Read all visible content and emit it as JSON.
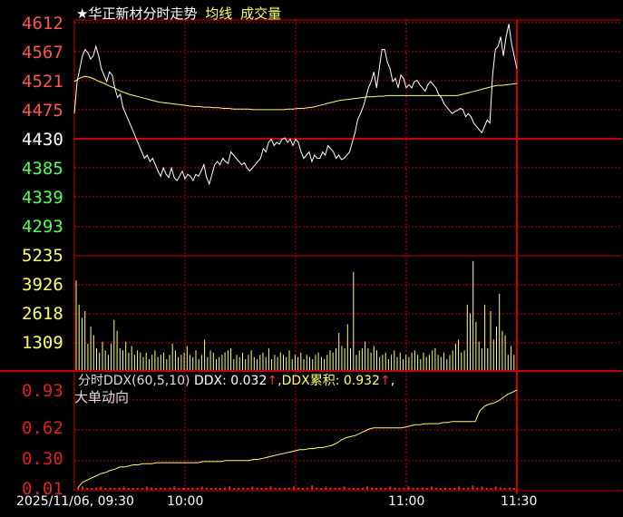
{
  "header": {
    "star": "★",
    "stock": "华正新材",
    "chart_name": "分时走势",
    "avg_label": "均线",
    "vol_label": "成交量"
  },
  "ddx_header": {
    "indicator": "分时DDX(60,5,10)",
    "ddx_label": "DDX: 0.032",
    "ddx_arrow": "↑",
    "ddx_sep": ",",
    "cum_label": "DDX累积: 0.932",
    "cum_arrow": "↑",
    "cum_sep": ",",
    "big_order": "大单动向"
  },
  "colors": {
    "background": "#000000",
    "grid": "#c80000",
    "price_line": "#ffffff",
    "avg_line": "#ffff66",
    "up_label": "#ff5555",
    "down_label": "#55ff55",
    "vol_label": "#ffff66",
    "ddx_label": "#dd2222",
    "vol_bar": "#ffff80"
  },
  "chart_data": [
    {
      "type": "line",
      "name": "price",
      "y_ticks": [
        "4612",
        "4567",
        "4521",
        "4475",
        "4430",
        "4385",
        "4339",
        "4293"
      ],
      "ylim": [
        4293,
        4612
      ],
      "prev_close": 4430,
      "series": [
        {
          "name": "price",
          "values": [
            4470,
            4520,
            4540,
            4560,
            4570,
            4565,
            4555,
            4560,
            4575,
            4560,
            4540,
            4530,
            4520,
            4535,
            4530,
            4510,
            4495,
            4500,
            4480,
            4470,
            4460,
            4450,
            4440,
            4430,
            4420,
            4410,
            4400,
            4405,
            4395,
            4400,
            4390,
            4380,
            4372,
            4385,
            4375,
            4370,
            4385,
            4370,
            4365,
            4372,
            4380,
            4368,
            4375,
            4372,
            4365,
            4375,
            4372,
            4380,
            4390,
            4370,
            4360,
            4375,
            4390,
            4395,
            4390,
            4400,
            4395,
            4392,
            4410,
            4405,
            4400,
            4395,
            4390,
            4393,
            4385,
            4380,
            4385,
            4390,
            4395,
            4400,
            4415,
            4410,
            4425,
            4430,
            4420,
            4425,
            4422,
            4430,
            4432,
            4425,
            4430,
            4420,
            4430,
            4425,
            4410,
            4400,
            4405,
            4410,
            4395,
            4405,
            4400,
            4400,
            4410,
            4405,
            4420,
            4415,
            4410,
            4400,
            4405,
            4398,
            4400,
            4405,
            4410,
            4425,
            4440,
            4460,
            4470,
            4480,
            4495,
            4510,
            4520,
            4535,
            4510,
            4540,
            4570,
            4570,
            4550,
            4540,
            4520,
            4525,
            4510,
            4530,
            4525,
            4510,
            4515,
            4510,
            4520,
            4522,
            4515,
            4510,
            4505,
            4515,
            4520,
            4515,
            4510,
            4500,
            4495,
            4485,
            4480,
            4475,
            4470,
            4473,
            4475,
            4478,
            4476,
            4465,
            4470,
            4465,
            4455,
            4450,
            4445,
            4440,
            4450,
            4460,
            4455,
            4530,
            4570,
            4575,
            4590,
            4560,
            4590,
            4610,
            4580,
            4560,
            4540
          ]
        },
        {
          "name": "average",
          "values": [
            4520,
            4525,
            4528,
            4527,
            4524,
            4520,
            4517,
            4513,
            4510,
            4506,
            4503,
            4500,
            4498,
            4496,
            4494,
            4492,
            4490,
            4488,
            4487,
            4486,
            4485,
            4484,
            4483,
            4482,
            4481,
            4481,
            4480,
            4480,
            4479,
            4479,
            4478,
            4478,
            4477,
            4477,
            4477,
            4477,
            4476,
            4476,
            4476,
            4476,
            4476,
            4476,
            4476,
            4477,
            4477,
            4478,
            4478,
            4479,
            4480,
            4482,
            4484,
            4486,
            4488,
            4490,
            4491,
            4492,
            4493,
            4494,
            4495,
            4496,
            4496,
            4497,
            4497,
            4498,
            4498,
            4498,
            4498,
            4498,
            4498,
            4498,
            4498,
            4498,
            4498,
            4498,
            4498,
            4498,
            4498,
            4498,
            4500,
            4502,
            4504,
            4506,
            4508,
            4510,
            4512,
            4514,
            4514,
            4515,
            4516,
            4517
          ]
        }
      ]
    },
    {
      "type": "bar",
      "name": "volume",
      "y_ticks": [
        "5235",
        "3926",
        "2618",
        "1309"
      ],
      "ylim": [
        0,
        5235
      ],
      "values": [
        4100,
        3000,
        2400,
        2700,
        1200,
        2000,
        1600,
        1000,
        800,
        1300,
        900,
        700,
        1200,
        2300,
        1800,
        1000,
        900,
        1300,
        800,
        1100,
        700,
        900,
        800,
        600,
        800,
        500,
        700,
        900,
        600,
        700,
        800,
        500,
        700,
        1200,
        900,
        600,
        700,
        800,
        1100,
        700,
        600,
        900,
        500,
        700,
        1400,
        600,
        900,
        800,
        500,
        600,
        700,
        800,
        900,
        1000,
        500,
        700,
        600,
        800,
        500,
        700,
        900,
        600,
        500,
        700,
        800,
        600,
        1000,
        500,
        700,
        600,
        800,
        700,
        600,
        900,
        500,
        700,
        600,
        800,
        500,
        700,
        600,
        500,
        700,
        800,
        600,
        500,
        700,
        900,
        800,
        1000,
        1700,
        1100,
        1000,
        2100,
        1000,
        4500,
        700,
        900,
        1000,
        1300,
        1000,
        800,
        1100,
        900,
        600,
        700,
        800,
        500,
        700,
        900,
        600,
        800,
        500,
        700,
        600,
        800,
        900,
        700,
        500,
        800,
        600,
        700,
        900,
        1000,
        700,
        600,
        800,
        500,
        700,
        900,
        1200,
        1400,
        800,
        900,
        3000,
        2600,
        5000,
        2200,
        1300,
        1000,
        3000,
        1000,
        2700,
        1400,
        2000,
        3500,
        1800,
        1600,
        700,
        1100,
        700
      ]
    },
    {
      "type": "line",
      "name": "ddx",
      "y_ticks": [
        "0.93",
        "0.62",
        "0.30",
        "0.01"
      ],
      "ylim": [
        0.01,
        0.93
      ],
      "series": [
        {
          "name": "DDX累积",
          "values": [
            0.03,
            0.08,
            0.1,
            0.12,
            0.14,
            0.16,
            0.17,
            0.19,
            0.2,
            0.22,
            0.22,
            0.23,
            0.24,
            0.24,
            0.25,
            0.25,
            0.25,
            0.26,
            0.26,
            0.26,
            0.26,
            0.26,
            0.26,
            0.26,
            0.26,
            0.26,
            0.26,
            0.27,
            0.27,
            0.27,
            0.27,
            0.27,
            0.28,
            0.28,
            0.28,
            0.28,
            0.28,
            0.28,
            0.29,
            0.29,
            0.3,
            0.31,
            0.32,
            0.33,
            0.34,
            0.35,
            0.36,
            0.37,
            0.38,
            0.38,
            0.39,
            0.39,
            0.4,
            0.4,
            0.41,
            0.42,
            0.44,
            0.47,
            0.49,
            0.5,
            0.51,
            0.53,
            0.55,
            0.57,
            0.58,
            0.58,
            0.58,
            0.58,
            0.58,
            0.58,
            0.58,
            0.59,
            0.6,
            0.61,
            0.61,
            0.62,
            0.62,
            0.62,
            0.62,
            0.63,
            0.63,
            0.64,
            0.64,
            0.64,
            0.64,
            0.64,
            0.64,
            0.74,
            0.78,
            0.8,
            0.81,
            0.83,
            0.86,
            0.89,
            0.91,
            0.93
          ]
        }
      ],
      "bars": [
        0.02,
        0.03,
        0.02,
        0.01,
        0.02,
        0.03,
        0.01,
        0.02,
        0.01,
        0.02,
        0.03,
        0.01,
        0.02,
        0.02,
        0.01,
        0.03,
        0.02,
        0.01,
        0.02,
        0.01,
        0.02,
        0.03,
        0.01,
        0.02,
        0.01,
        0.02,
        0.01,
        0.03,
        0.02,
        0.01,
        0.02,
        0.01,
        0.02,
        0.03,
        0.01,
        0.02,
        0.02,
        0.01,
        0.03,
        0.02,
        0.01,
        0.02,
        0.03,
        0.01,
        0.02,
        0.01,
        0.02,
        0.03,
        0.02,
        0.01,
        0.02,
        0.04,
        0.02,
        0.01,
        0.03,
        0.02,
        0.01,
        0.02,
        0.03,
        0.01,
        0.02,
        0.01,
        0.02,
        0.03,
        0.02,
        0.01,
        0.02,
        0.01,
        0.03,
        0.02,
        0.01,
        0.02,
        0.03,
        0.01,
        0.02,
        0.02,
        0.01,
        0.03,
        0.02,
        0.01,
        0.02,
        0.01,
        0.02,
        0.03,
        0.01,
        0.02,
        0.04,
        0.02,
        0.03,
        0.02,
        0.01,
        0.03,
        0.02,
        0.01,
        0.02,
        0.01
      ]
    }
  ],
  "x_axis": {
    "labels": [
      "2025/11/06, 09:30",
      "10:00",
      "11:00",
      "11:30"
    ]
  }
}
